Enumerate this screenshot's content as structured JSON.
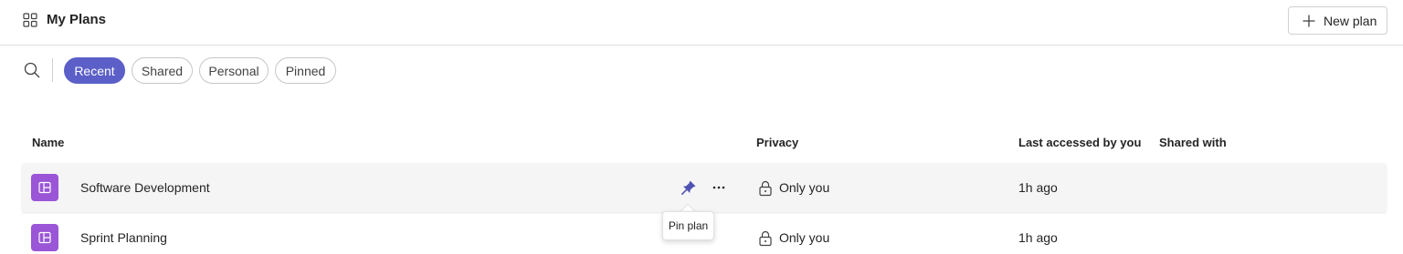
{
  "header": {
    "title": "My Plans",
    "new_plan_label": "New plan"
  },
  "filters": {
    "search_icon": "search-icon",
    "pills": [
      {
        "label": "Recent",
        "active": true
      },
      {
        "label": "Shared",
        "active": false
      },
      {
        "label": "Personal",
        "active": false
      },
      {
        "label": "Pinned",
        "active": false
      }
    ]
  },
  "table": {
    "columns": [
      "Name",
      "Privacy",
      "Last accessed by you",
      "Shared with"
    ],
    "rows": [
      {
        "name": "Software Development",
        "privacy": "Only you",
        "last_accessed": "1h ago",
        "shared_with": ""
      },
      {
        "name": "Sprint Planning",
        "privacy": "Only you",
        "last_accessed": "1h ago",
        "shared_with": ""
      }
    ]
  },
  "tooltip": {
    "text": "Pin plan"
  },
  "colors": {
    "accent": "#5b5fc7",
    "plan_icon": "#9a56d6",
    "hover_row": "#f5f5f5"
  }
}
